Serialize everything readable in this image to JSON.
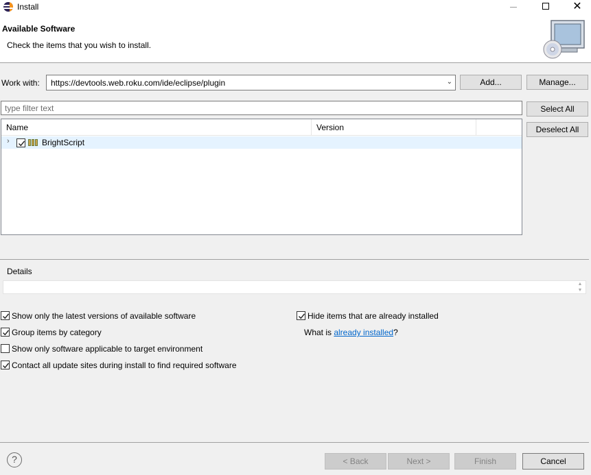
{
  "window": {
    "title": "Install",
    "close_glyph": "✕"
  },
  "header": {
    "title": "Available Software",
    "subtitle": "Check the items that you wish to install."
  },
  "work_with": {
    "label": "Work with:",
    "value": "https://devtools.web.roku.com/ide/eclipse/plugin",
    "add_label": "Add...",
    "manage_label": "Manage..."
  },
  "filter": {
    "placeholder": "type filter text"
  },
  "buttons": {
    "select_all": "Select All",
    "deselect_all": "Deselect All"
  },
  "tree": {
    "columns": [
      "Name",
      "Version"
    ],
    "rows": [
      {
        "name": "BrightScript",
        "version": "",
        "checked": true,
        "expanded": false
      }
    ]
  },
  "details": {
    "label": "Details"
  },
  "options": {
    "latest_versions": {
      "label": "Show only the latest versions of available software",
      "checked": true
    },
    "group_by_category": {
      "label": "Group items by category",
      "checked": true
    },
    "target_env": {
      "label": "Show only software applicable to target environment",
      "checked": false
    },
    "contact_sites": {
      "label": "Contact all update sites during install to find required software",
      "checked": true
    },
    "hide_installed": {
      "label": "Hide items that are already installed",
      "checked": true
    },
    "what_is_prefix": "What is ",
    "already_installed_link": "already installed",
    "what_is_suffix": "?"
  },
  "footer": {
    "back": "< Back",
    "next": "Next >",
    "finish": "Finish",
    "cancel": "Cancel",
    "help_glyph": "?"
  },
  "colors": {
    "accent": "#0066cc",
    "selection": "#e5f3ff"
  },
  "icons": [
    "eclipse-app-icon",
    "minimize-icon",
    "maximize-icon",
    "close-icon",
    "install-banner-icon",
    "dropdown-arrow-icon",
    "chevron-right-icon",
    "feature-icon",
    "help-icon"
  ]
}
